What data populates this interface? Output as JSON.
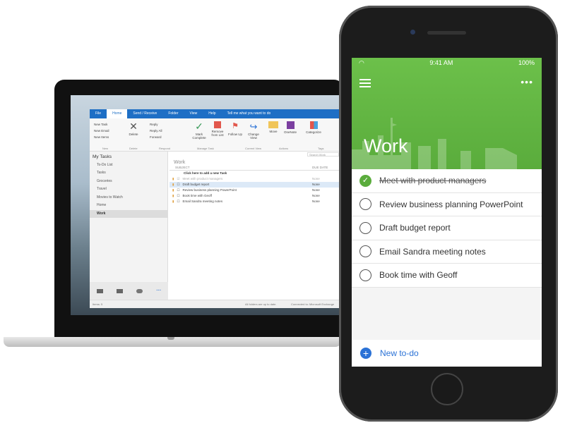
{
  "outlook": {
    "tabs": [
      "File",
      "Home",
      "Send / Receive",
      "Folder",
      "View",
      "Help"
    ],
    "tell_me": "Tell me what you want to do",
    "ribbon": {
      "new_task": "New Task",
      "new_email": "New Email",
      "new_items": "New Items",
      "delete": "Delete",
      "reply": "Reply",
      "reply_all": "Reply All",
      "forward": "Forward",
      "mark_complete": "Mark Complete",
      "remove_from_list": "Remove from List",
      "follow_up": "Follow Up",
      "change_view": "Change View",
      "move": "Move",
      "onenote": "OneNote",
      "categorize": "Categorize"
    },
    "groups": [
      "New",
      "Delete",
      "Respond",
      "Manage Task",
      "Current View",
      "Actions",
      "Tags"
    ],
    "sidebar": {
      "header": "My Tasks",
      "items": [
        "To-Do List",
        "Tasks",
        "Groceries",
        "Travel",
        "Movies to Watch",
        "Home",
        "Work"
      ]
    },
    "search_placeholder": "Search Work",
    "folder_title": "Work",
    "columns": {
      "subject": "SUBJECT",
      "due_date": "DUE DATE"
    },
    "add_new": "Click here to add a new Task",
    "tasks": [
      {
        "subject": "Meet with product managers",
        "due": "None",
        "done": true
      },
      {
        "subject": "Draft budget report",
        "due": "None",
        "done": false
      },
      {
        "subject": "Review business planning PowerPoint",
        "due": "None",
        "done": false
      },
      {
        "subject": "Book time with Geoff",
        "due": "None",
        "done": false
      },
      {
        "subject": "Email Sandra meeting notes",
        "due": "None",
        "done": false
      }
    ],
    "status": {
      "items": "Items: 5",
      "sync": "All folders are up to date.",
      "connected": "Connected to: Microsoft Exchange"
    }
  },
  "phone": {
    "status_bar": {
      "time": "9:41 AM",
      "battery": "100%"
    },
    "list_title": "Work",
    "tasks": [
      {
        "label": "Meet with product managers",
        "done": true
      },
      {
        "label": "Review business planning PowerPoint",
        "done": false
      },
      {
        "label": "Draft budget report",
        "done": false
      },
      {
        "label": "Email Sandra meeting notes",
        "done": false
      },
      {
        "label": "Book time with Geoff",
        "done": false
      }
    ],
    "new_todo": "New to-do",
    "accent": "#5aac3c",
    "link_color": "#2b72d6"
  }
}
